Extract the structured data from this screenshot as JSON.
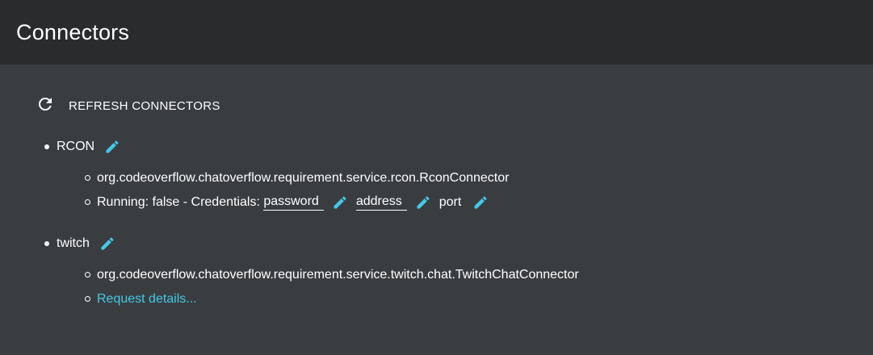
{
  "header": {
    "title": "Connectors"
  },
  "toolbar": {
    "refresh_label": "REFRESH CONNECTORS",
    "refresh_icon": "refresh-icon"
  },
  "colors": {
    "accent": "#43c9e6",
    "header_bg": "#292b2d",
    "page_bg": "#3a3d40"
  },
  "connectors": [
    {
      "name": "RCON",
      "class_name": "org.codeoverflow.chatoverflow.requirement.service.rcon.RconConnector",
      "status_prefix": "Running: false - Credentials: ",
      "credentials": [
        "password",
        "address",
        "port"
      ]
    },
    {
      "name": "twitch",
      "class_name": "org.codeoverflow.chatoverflow.requirement.service.twitch.chat.TwitchChatConnector",
      "request_details": "Request details..."
    }
  ]
}
